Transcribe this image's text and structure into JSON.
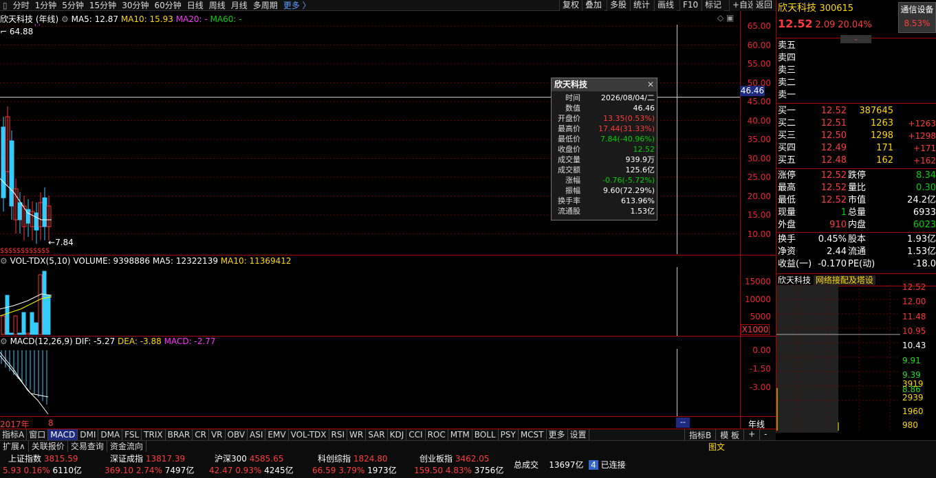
{
  "toolbar": {
    "items": [
      "分时",
      "1分钟",
      "5分钟",
      "15分钟",
      "30分钟",
      "60分钟",
      "日线",
      "周线",
      "月线",
      "多周期",
      "更多 〉"
    ],
    "right": [
      "复权",
      "叠加",
      "多股",
      "统计",
      "画线",
      "F10",
      "标记",
      "+自选",
      "返回"
    ]
  },
  "kline": {
    "title": "欣天科技 (年线)",
    "ma5": "MA5: 12.87",
    "ma10": "MA10: 15.93",
    "ma20": "MA20: -",
    "ma60": "MA60: -",
    "high_mark": "64.88",
    "low_mark": "7.84",
    "cursor_price": "46.46",
    "yticks": [
      "65.00",
      "60.00",
      "55.00",
      "50.00",
      "45.00",
      "40.00",
      "35.00",
      "30.00",
      "25.00",
      "20.00",
      "15.00",
      "10.00"
    ]
  },
  "vol": {
    "label": "VOL-TDX(5,10)",
    "volume": "VOLUME: 9398886",
    "ma5": "MA5: 12322139",
    "ma10": "MA10: 11369412",
    "yticks": [
      "15000",
      "10000",
      "5000"
    ],
    "unit": "X1000"
  },
  "macd": {
    "label": "MACD(12,26,9)",
    "dif": "DIF: -5.27",
    "dea": "DEA: -3.88",
    "macd": "MACD: -2.77",
    "yticks": [
      "0.00",
      "-1.50",
      "-3.00"
    ]
  },
  "xaxis": {
    "year": "2017年",
    "mark": "8",
    "cursor": "--",
    "period": "年线"
  },
  "tooltip": {
    "title": "欣天科技",
    "rows": [
      {
        "k": "时间",
        "v": "2026/08/04/二",
        "c": "white"
      },
      {
        "k": "数值",
        "v": "46.46",
        "c": "white"
      },
      {
        "k": "开盘价",
        "v": "13.35(0.53%)",
        "c": "red"
      },
      {
        "k": "最高价",
        "v": "17.44(31.33%)",
        "c": "red"
      },
      {
        "k": "最低价",
        "v": "7.84(-40.96%)",
        "c": "green"
      },
      {
        "k": "收盘价",
        "v": "12.52",
        "c": "green"
      },
      {
        "k": "成交量",
        "v": "939.9万",
        "c": "white"
      },
      {
        "k": "成交额",
        "v": "125.6亿",
        "c": "white"
      },
      {
        "k": "涨幅",
        "v": "-0.76(-5.72%)",
        "c": "green"
      },
      {
        "k": "振幅",
        "v": "9.60(72.29%)",
        "c": "white"
      },
      {
        "k": "换手率",
        "v": "613.96%",
        "c": "white"
      },
      {
        "k": "流通股",
        "v": "1.53亿",
        "c": "white"
      }
    ]
  },
  "quote": {
    "name": "欣天科技",
    "code": "300615",
    "sector": "通信设备",
    "sector_pct": "8.53%",
    "price": "12.52",
    "change": "2.09",
    "pct": "20.04%"
  },
  "sells": [
    "卖五",
    "卖四",
    "卖三",
    "卖二",
    "卖一"
  ],
  "buys": [
    {
      "l": "买一",
      "p": "12.52",
      "v": "387645",
      "d": ""
    },
    {
      "l": "买二",
      "p": "12.51",
      "v": "1263",
      "d": "+1263"
    },
    {
      "l": "买三",
      "p": "12.50",
      "v": "1298",
      "d": "+1298"
    },
    {
      "l": "买四",
      "p": "12.49",
      "v": "171",
      "d": "+171"
    },
    {
      "l": "买五",
      "p": "12.48",
      "v": "162",
      "d": "+162"
    }
  ],
  "stats": [
    {
      "a": "涨停",
      "av": "12.52",
      "ac": "red",
      "b": "跌停",
      "bv": "8.34",
      "bc": "green"
    },
    {
      "a": "最高",
      "av": "12.52",
      "ac": "red",
      "b": "量比",
      "bv": "0.30",
      "bc": "green"
    },
    {
      "a": "最低",
      "av": "12.52",
      "ac": "red",
      "b": "市值",
      "bv": "24.2亿",
      "bc": "white"
    },
    {
      "a": "现量",
      "av": "1",
      "ac": "green",
      "b": "总量",
      "bv": "6933",
      "bc": "white"
    },
    {
      "a": "外盘",
      "av": "910",
      "ac": "red",
      "b": "内盘",
      "bv": "6023",
      "bc": "green"
    }
  ],
  "stats2": [
    {
      "a": "换手",
      "av": "0.45%",
      "b": "股本",
      "bv": "1.93亿"
    },
    {
      "a": "净资",
      "av": "2.44",
      "b": "流通",
      "bv": "1.53亿"
    },
    {
      "a": "收益(一)",
      "av": "-0.170",
      "b": "PE(动)",
      "bv": "-18.0"
    }
  ],
  "mini": {
    "name": "欣天科技",
    "concept": "网络接配及塔设",
    "prices": [
      "12.52",
      "12.00",
      "11.48",
      "10.95",
      "10.43",
      "9.91",
      "9.39",
      "8.86"
    ],
    "vols": [
      "3919",
      "2939",
      "1960",
      "980"
    ]
  },
  "tabs": [
    "指标A",
    "窗口",
    "MACD",
    "DMI",
    "DMA",
    "FSL",
    "TRIX",
    "BRAR",
    "CR",
    "VR",
    "OBV",
    "ASI",
    "EMV",
    "VOL-TDX",
    "RSI",
    "WR",
    "SAR",
    "KDJ",
    "CCI",
    "ROC",
    "MTM",
    "BOLL",
    "PSY",
    "MCST",
    "更多",
    "设置"
  ],
  "tabs_right": [
    "指标B",
    "模 板",
    "+",
    "-"
  ],
  "row2": [
    "扩展∧",
    "关联报价",
    "交易查询",
    "资金流向"
  ],
  "row2_right": "图文",
  "indices": [
    {
      "n": "上证指数",
      "v": "3815.59",
      "c": "5.93",
      "p": "0.16%",
      "a": "6110亿"
    },
    {
      "n": "深证成指",
      "v": "13817.39",
      "c": "369.10",
      "p": "2.74%",
      "a": "7497亿"
    },
    {
      "n": "沪深300",
      "v": "4585.65",
      "c": "42.47",
      "p": "0.93%",
      "a": "4245亿"
    },
    {
      "n": "科创综指",
      "v": "1824.80",
      "c": "66.59",
      "p": "3.79%",
      "a": "1973亿"
    },
    {
      "n": "创业板指",
      "v": "3462.05",
      "c": "159.50",
      "p": "4.83%",
      "a": "3756亿"
    }
  ],
  "total": {
    "label": "总成交",
    "value": "13697亿",
    "conn_num": "4",
    "conn": "已连接"
  },
  "chart_data": {
    "type": "candlestick",
    "series": [
      {
        "name": "K",
        "values": []
      }
    ],
    "y_range": [
      7.84,
      64.88
    ]
  }
}
